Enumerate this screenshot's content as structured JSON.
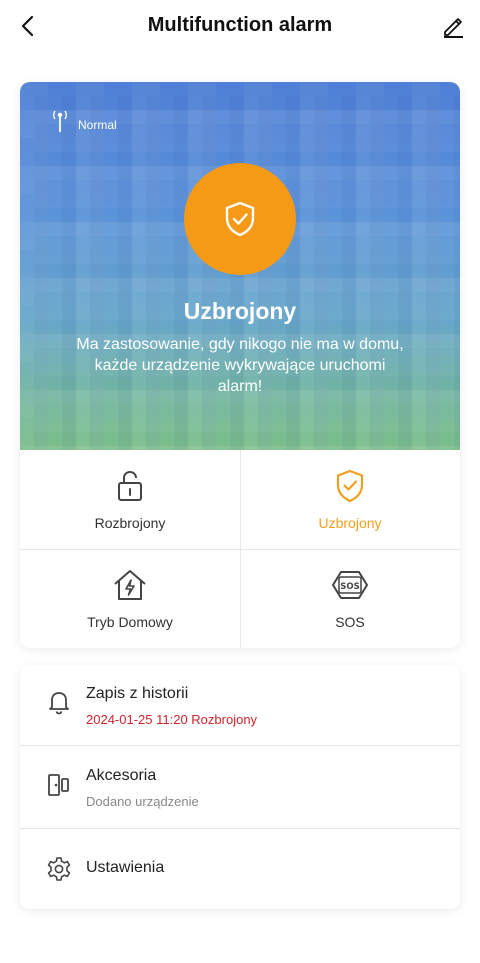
{
  "header": {
    "title": "Multifunction alarm",
    "back_icon": "chevron-left-icon",
    "edit_icon": "pencil-icon"
  },
  "hero": {
    "signal_icon": "antenna-icon",
    "signal_status": "Normal",
    "status_icon": "shield-check-icon",
    "status_title": "Uzbrojony",
    "description": "Ma zastosowanie, gdy nikogo nie ma w domu, każde urządzenie wykrywające uruchomi alarm!",
    "accent_color": "#f59a17"
  },
  "modes": [
    {
      "label": "Rozbrojony",
      "icon": "unlocked-padlock-icon",
      "active": false
    },
    {
      "label": "Uzbrojony",
      "icon": "shield-check-icon",
      "active": true
    },
    {
      "label": "Tryb Domowy",
      "icon": "home-bolt-icon",
      "active": false
    },
    {
      "label": "SOS",
      "icon": "sos-icon",
      "active": false
    }
  ],
  "list": {
    "history": {
      "title": "Zapis z historii",
      "subtitle": "2024-01-25 11:20 Rozbrojony",
      "icon": "bell-icon"
    },
    "accessories": {
      "title": "Akcesoria",
      "subtitle": "Dodano urządzenie",
      "icon": "door-sensor-icon"
    },
    "settings": {
      "title": "Ustawienia",
      "icon": "gear-icon"
    }
  }
}
